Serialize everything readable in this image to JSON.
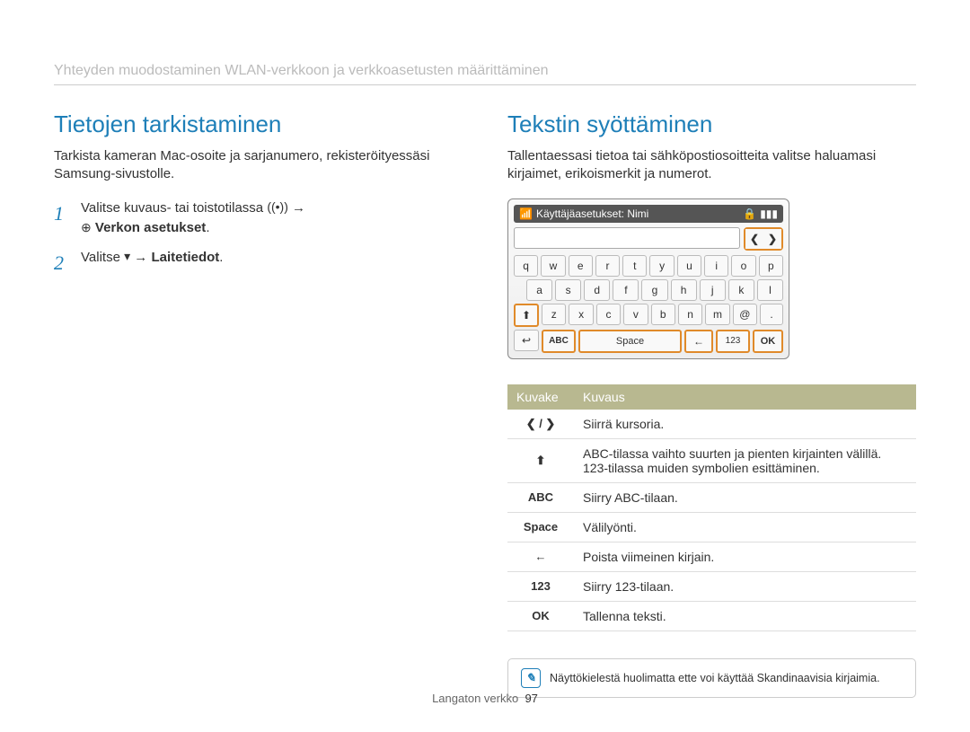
{
  "breadcrumb": "Yhteyden muodostaminen WLAN-verkkoon ja verkkoasetusten määrittäminen",
  "left": {
    "heading": "Tietojen tarkistaminen",
    "intro": "Tarkista kameran Mac-osoite ja sarjanumero, rekisteröityessäsi Samsung-sivustolle.",
    "step1_a": "Valitse kuvaus- tai toistotilassa ",
    "step1_icon": "((•))",
    "step1_arrow": "→",
    "step1_b_icon": "⊕",
    "step1_b_bold": "Verkon asetukset",
    "step1_b_after": ".",
    "step2_a": "Valitse ",
    "step2_icon": "▾",
    "step2_arrow": " → ",
    "step2_bold": "Laitetiedot",
    "step2_after": "."
  },
  "right": {
    "heading": "Tekstin syöttäminen",
    "intro": "Tallentaessasi tietoa tai sähköpostiosoitteita valitse haluamasi kirjaimet, erikoismerkit ja numerot.",
    "kb_title": "Käyttäjäasetukset: Nimi",
    "rows": {
      "r1": [
        "q",
        "w",
        "e",
        "r",
        "t",
        "y",
        "u",
        "i",
        "o",
        "p"
      ],
      "r2": [
        "a",
        "s",
        "d",
        "f",
        "g",
        "h",
        "j",
        "k",
        "l"
      ],
      "r3": [
        "z",
        "x",
        "c",
        "v",
        "b",
        "n",
        "m",
        "@",
        "."
      ]
    },
    "space": "Space",
    "abc": "ABC",
    "num": "123",
    "ok": "OK",
    "table": {
      "h1": "Kuvake",
      "h2": "Kuvaus",
      "r1_icon": "❮ / ❯",
      "r1": "Siirrä kursoria.",
      "r2_icon": "⬆",
      "r2": "ABC-tilassa vaihto suurten ja pienten kirjainten välillä. 123-tilassa muiden symbolien esittäminen.",
      "r3_icon": "ABC",
      "r3": "Siirry ABC-tilaan.",
      "r4_icon": "Space",
      "r4": "Välilyönti.",
      "r5_icon": "←",
      "r5": "Poista viimeinen kirjain.",
      "r6_icon": "123",
      "r6": "Siirry 123-tilaan.",
      "r7_icon": "OK",
      "r7": "Tallenna teksti."
    },
    "note": "Näyttökielestä huolimatta ette voi käyttää Skandinaavisia kirjaimia."
  },
  "footer_label": "Langaton verkko",
  "footer_page": "97"
}
